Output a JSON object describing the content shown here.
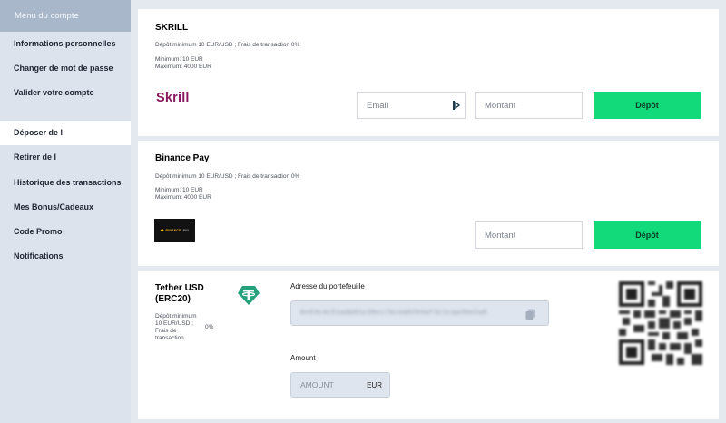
{
  "sidebar": {
    "header": "Menu du compte",
    "items": [
      {
        "label": "Informations personnelles"
      },
      {
        "label": "Changer de mot de passe"
      },
      {
        "label": "Valider votre compte"
      },
      {
        "label": "Déposer de l"
      },
      {
        "label": "Retirer de l"
      },
      {
        "label": "Historique des transactions"
      },
      {
        "label": "Mes Bonus/Cadeaux"
      },
      {
        "label": "Code Promo"
      },
      {
        "label": "Notifications"
      }
    ],
    "active_item": "Déposer de l"
  },
  "skrill": {
    "title": "SKRILL",
    "info": "Dépôt minimum 10 EUR/USD ; Frais de transaction 0%",
    "minimum": "Minimum: 10 EUR",
    "maximum": "Maximum: 4000 EUR",
    "logo_text": "Skrill",
    "email_placeholder": "Email",
    "amount_placeholder": "Montant",
    "button": "Dépôt"
  },
  "binance": {
    "title": "Binance Pay",
    "info": "Dépôt minimum 10 EUR/USD ; Frais de transaction 0%",
    "minimum": "Minimum: 10 EUR",
    "maximum": "Maximum: 4000 EUR",
    "logo_text": "BINANCE",
    "logo_sub": "PAY",
    "amount_placeholder": "Montant",
    "button": "Dépôt"
  },
  "tether": {
    "title_line1": "Tether USD",
    "title_line2": "(ERC20)",
    "info_line1": "Dépôt minimum",
    "info_line2": "10 EUR/USD ;",
    "info_line3": "Frais de",
    "info_line4": "transaction",
    "fee": "0%",
    "address_label": "Adresse du portefeuille",
    "address": "0x63c4c51adb01c39cc7bcea0204af3c1caa36e2a8",
    "amount_label": "Amount",
    "amount_placeholder": "AMOUNT",
    "amount_unit": "EUR"
  },
  "colors": {
    "accent_green": "#12d97a",
    "skrill_purple": "#8a1a5f",
    "tether_green": "#26a17b",
    "binance_yellow": "#f0b90b",
    "sidebar_header": "#a9b7ca"
  },
  "icons": {
    "email_field": "key-icon",
    "address_copy": "copy-icon",
    "tether": "tether-logo-icon"
  }
}
